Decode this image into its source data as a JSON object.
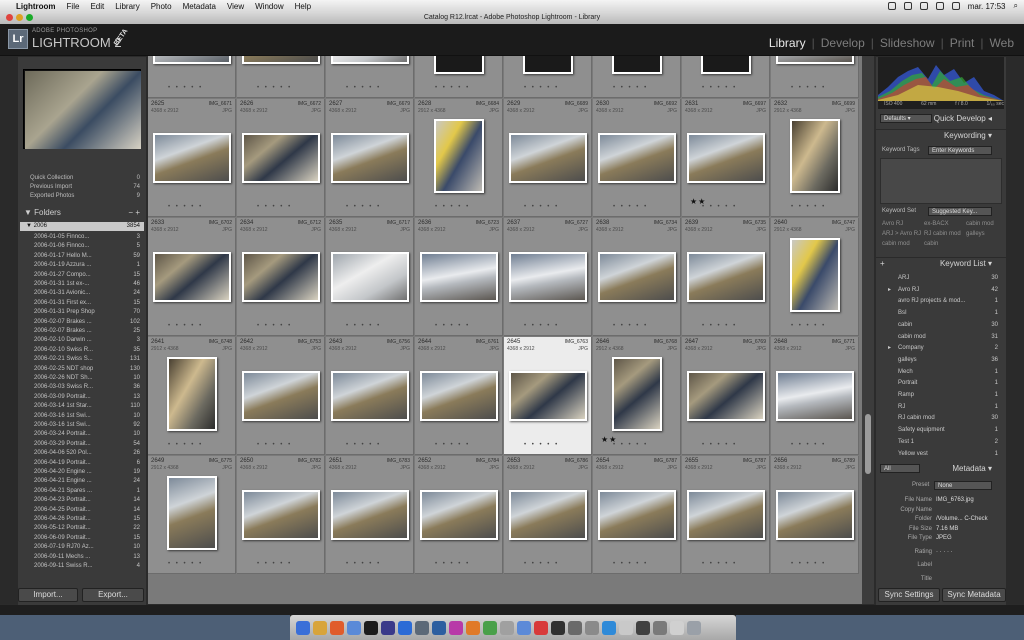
{
  "menubar": {
    "items": [
      "Lightroom",
      "File",
      "Edit",
      "Library",
      "Photo",
      "Metadata",
      "View",
      "Window",
      "Help"
    ],
    "clock": "mar. 17:53"
  },
  "window": {
    "title": "Catalog R12.lrcat - Adobe Photoshop Lightroom - Library"
  },
  "identity": {
    "logo": "Lr",
    "sub": "ADOBE PHOTOSHOP",
    "main": "LIGHTROOM 2",
    "badge": "BETA"
  },
  "modules": [
    "Library",
    "Develop",
    "Slideshow",
    "Print",
    "Web"
  ],
  "left": {
    "catalog_rows": [
      {
        "label": "Quick Collection",
        "count": "0"
      },
      {
        "label": "Previous Import",
        "count": "74"
      },
      {
        "label": "Exported Photos",
        "count": "9"
      }
    ],
    "folders_title": "Folders",
    "folder_root": {
      "label": "2006",
      "count": "3854"
    },
    "folders": [
      {
        "label": "2006-01-05 Finnco...",
        "count": "3"
      },
      {
        "label": "2006-01-06 Finnco...",
        "count": "5"
      },
      {
        "label": "2006-01-17 Hello M...",
        "count": "59"
      },
      {
        "label": "2006-01-19 Azzura ...",
        "count": "1"
      },
      {
        "label": "2006-01-27 Compo...",
        "count": "15"
      },
      {
        "label": "2006-01-31 1st ex-...",
        "count": "46"
      },
      {
        "label": "2006-01-31 Avionic...",
        "count": "24"
      },
      {
        "label": "2006-01-31 First ex...",
        "count": "15"
      },
      {
        "label": "2006-01-31 Prep Shop",
        "count": "70"
      },
      {
        "label": "2006-02-07 Brakes ...",
        "count": "102"
      },
      {
        "label": "2006-02-07 Brakes ...",
        "count": "25"
      },
      {
        "label": "2006-02-10 Darwin ...",
        "count": "3"
      },
      {
        "label": "2006-02-10 Swiss R...",
        "count": "35"
      },
      {
        "label": "2006-02-21 Swiss S...",
        "count": "131"
      },
      {
        "label": "2006-02-25 NDT shop",
        "count": "130"
      },
      {
        "label": "2006-02-26 NDT Sh...",
        "count": "10"
      },
      {
        "label": "2006-03-03 Swiss R...",
        "count": "36"
      },
      {
        "label": "2006-03-09 Portrait...",
        "count": "13"
      },
      {
        "label": "2006-03-14 1st Star...",
        "count": "110"
      },
      {
        "label": "2006-03-16 1st Swi...",
        "count": "10"
      },
      {
        "label": "2006-03-16 1st Swi...",
        "count": "92"
      },
      {
        "label": "2006-03-24 Portrait...",
        "count": "10"
      },
      {
        "label": "2006-03-29 Portrait...",
        "count": "54"
      },
      {
        "label": "2006-04-06 520 Pol...",
        "count": "26"
      },
      {
        "label": "2006-04-19 Portrait...",
        "count": "6"
      },
      {
        "label": "2006-04-20 Engine ...",
        "count": "19"
      },
      {
        "label": "2006-04-21 Engine ...",
        "count": "24"
      },
      {
        "label": "2006-04-21 Spares ...",
        "count": "1"
      },
      {
        "label": "2006-04-23 Portrait...",
        "count": "14"
      },
      {
        "label": "2006-04-25 Portrait...",
        "count": "14"
      },
      {
        "label": "2006-04-26 Portrait...",
        "count": "15"
      },
      {
        "label": "2006-05-12 Portrait...",
        "count": "22"
      },
      {
        "label": "2006-06-09 Portrait...",
        "count": "15"
      },
      {
        "label": "2006-07-19 RJ70 Az...",
        "count": "10"
      },
      {
        "label": "2006-09-11 Mechs ...",
        "count": "13"
      },
      {
        "label": "2006-09-11 Swiss R...",
        "count": "4"
      }
    ],
    "import_label": "Import...",
    "export_label": "Export..."
  },
  "grid": {
    "rows": [
      [
        {
          "num": "2617",
          "fn": "LH FR 10 to 14 04",
          "dim": "3000 x 1500",
          "ext": "JPG",
          "thumb": "fish"
        },
        {
          "num": "2618",
          "fn": "LH FR10 to 17",
          "dim": "3000 x 1500",
          "ext": "JPG",
          "thumb": "hangar"
        },
        {
          "num": "2619",
          "fn": "LH FR10 to 14 new skin",
          "dim": "3000 x 1500",
          "ext": "JPG",
          "thumb": "wing"
        },
        {
          "num": "2620",
          "fn": "IMG_6652",
          "dim": "2912 x 4368",
          "ext": "JPG",
          "thumb": "portrait"
        },
        {
          "num": "2621",
          "fn": "IMG_6654",
          "dim": "2912 x 4368",
          "ext": "JPG",
          "thumb": "portrait"
        },
        {
          "num": "2622",
          "fn": "IMG_6656",
          "dim": "2912 x 4368",
          "ext": "JPG",
          "thumb": "portrait"
        },
        {
          "num": "2623",
          "fn": "IMG_6658",
          "dim": "2912 x 4368",
          "ext": "JPG",
          "thumb": "portrait"
        },
        {
          "num": "2624",
          "fn": "IMG_6666",
          "dim": "4368 x 2912",
          "ext": "JPG",
          "thumb": "jet"
        }
      ],
      [
        {
          "num": "2625",
          "fn": "IMG_6671",
          "dim": "4368 x 2912",
          "ext": "JPG",
          "thumb": "hangar"
        },
        {
          "num": "2626",
          "fn": "IMG_6672",
          "dim": "4368 x 2912",
          "ext": "JPG",
          "thumb": "worker"
        },
        {
          "num": "2627",
          "fn": "IMG_6679",
          "dim": "4368 x 2912",
          "ext": "JPG",
          "thumb": "hangar"
        },
        {
          "num": "2628",
          "fn": "IMG_6684",
          "dim": "2912 x 4368",
          "ext": "JPG",
          "thumb": "scaffold"
        },
        {
          "num": "2629",
          "fn": "IMG_6689",
          "dim": "4368 x 2912",
          "ext": "JPG",
          "thumb": "hangar"
        },
        {
          "num": "2630",
          "fn": "IMG_6692",
          "dim": "4368 x 2912",
          "ext": "JPG",
          "thumb": "hangar"
        },
        {
          "num": "2631",
          "fn": "IMG_6697",
          "dim": "4368 x 2912",
          "ext": "JPG",
          "thumb": "hangar",
          "stars": "★★"
        },
        {
          "num": "2632",
          "fn": "IMG_6699",
          "dim": "2912 x 4368",
          "ext": "JPG",
          "thumb": "engine"
        }
      ],
      [
        {
          "num": "2633",
          "fn": "IMG_6702",
          "dim": "4368 x 2912",
          "ext": "JPG",
          "thumb": "worker"
        },
        {
          "num": "2634",
          "fn": "IMG_6712",
          "dim": "4368 x 2912",
          "ext": "JPG",
          "thumb": "worker"
        },
        {
          "num": "2635",
          "fn": "IMG_6717",
          "dim": "4368 x 2912",
          "ext": "JPG",
          "thumb": "wing"
        },
        {
          "num": "2636",
          "fn": "IMG_6723",
          "dim": "4368 x 2912",
          "ext": "JPG",
          "thumb": "jet"
        },
        {
          "num": "2637",
          "fn": "IMG_6727",
          "dim": "4368 x 2912",
          "ext": "JPG",
          "thumb": "jet"
        },
        {
          "num": "2638",
          "fn": "IMG_6734",
          "dim": "4368 x 2912",
          "ext": "JPG",
          "thumb": "hangar"
        },
        {
          "num": "2639",
          "fn": "IMG_6735",
          "dim": "4368 x 2912",
          "ext": "JPG",
          "thumb": "hangar"
        },
        {
          "num": "2640",
          "fn": "IMG_6747",
          "dim": "2912 x 4368",
          "ext": "JPG",
          "thumb": "scaffold"
        }
      ],
      [
        {
          "num": "2641",
          "fn": "IMG_6748",
          "dim": "2912 x 4368",
          "ext": "JPG",
          "thumb": "engine"
        },
        {
          "num": "2642",
          "fn": "IMG_6753",
          "dim": "4368 x 2912",
          "ext": "JPG",
          "thumb": "hangar"
        },
        {
          "num": "2643",
          "fn": "IMG_6756",
          "dim": "4368 x 2912",
          "ext": "JPG",
          "thumb": "hangar"
        },
        {
          "num": "2644",
          "fn": "IMG_6761",
          "dim": "4368 x 2912",
          "ext": "JPG",
          "thumb": "hangar"
        },
        {
          "num": "2645",
          "fn": "IMG_6763",
          "dim": "4368 x 2912",
          "ext": "JPG",
          "thumb": "worker",
          "sel": true
        },
        {
          "num": "2646",
          "fn": "IMG_6768",
          "dim": "2912 x 4368",
          "ext": "JPG",
          "thumb": "worker",
          "stars": "★★"
        },
        {
          "num": "2647",
          "fn": "IMG_6769",
          "dim": "4368 x 2912",
          "ext": "JPG",
          "thumb": "worker"
        },
        {
          "num": "2648",
          "fn": "IMG_6771",
          "dim": "4368 x 2912",
          "ext": "JPG",
          "thumb": "jet"
        }
      ],
      [
        {
          "num": "2649",
          "fn": "IMG_6775",
          "dim": "2912 x 4368",
          "ext": "JPG",
          "thumb": "hangar"
        },
        {
          "num": "2650",
          "fn": "IMG_6782",
          "dim": "4368 x 2912",
          "ext": "JPG",
          "thumb": "hangar"
        },
        {
          "num": "2651",
          "fn": "IMG_6783",
          "dim": "4368 x 2912",
          "ext": "JPG",
          "thumb": "hangar"
        },
        {
          "num": "2652",
          "fn": "IMG_6784",
          "dim": "4368 x 2912",
          "ext": "JPG",
          "thumb": "hangar"
        },
        {
          "num": "2653",
          "fn": "IMG_6786",
          "dim": "4368 x 2912",
          "ext": "JPG",
          "thumb": "hangar"
        },
        {
          "num": "2654",
          "fn": "IMG_6787",
          "dim": "4368 x 2912",
          "ext": "JPG",
          "thumb": "hangar"
        },
        {
          "num": "2655",
          "fn": "IMG_6787",
          "dim": "4368 x 2912",
          "ext": "JPG",
          "thumb": "hangar"
        },
        {
          "num": "2656",
          "fn": "IMG_6789",
          "dim": "4368 x 2912",
          "ext": "JPG",
          "thumb": "hangar"
        }
      ]
    ]
  },
  "right": {
    "hist_info": [
      "ISO 400",
      "62 mm",
      "f / 8.0",
      "1/₆₀ sec"
    ],
    "quick_develop": {
      "preset_label": "Defaults",
      "title": "Quick Develop"
    },
    "keywording": {
      "title": "Keywording",
      "tags_label": "Keyword Tags",
      "tags_value": "Enter Keywords",
      "set_label": "Keyword Set",
      "set_value": "Suggested Key...",
      "suggestions": [
        "Avro RJ",
        "ex-BACX",
        "cabin mod",
        "ARJ > Avro RJ",
        "RJ cabin mod",
        "galleys",
        "cabin mod",
        "cabin"
      ]
    },
    "keyword_list": {
      "title": "Keyword List",
      "items": [
        {
          "label": "ARJ",
          "count": "30"
        },
        {
          "label": "Avro RJ",
          "count": "42",
          "arrow": true
        },
        {
          "label": "avro RJ projects & mod...",
          "count": "1"
        },
        {
          "label": "BsI",
          "count": "1"
        },
        {
          "label": "cabin",
          "count": "30"
        },
        {
          "label": "cabin mod",
          "count": "31"
        },
        {
          "label": "Company",
          "count": "2",
          "arrow": true
        },
        {
          "label": "galleys",
          "count": "36"
        },
        {
          "label": "Mech",
          "count": "1"
        },
        {
          "label": "Portrait",
          "count": "1"
        },
        {
          "label": "Ramp",
          "count": "1"
        },
        {
          "label": "RJ",
          "count": "1"
        },
        {
          "label": "RJ cabin mod",
          "count": "30"
        },
        {
          "label": "Safety equipment",
          "count": "1"
        },
        {
          "label": "Test 1",
          "count": "2"
        },
        {
          "label": "Yellow vest",
          "count": "1"
        }
      ]
    },
    "metadata": {
      "filter": "All",
      "title": "Metadata",
      "preset_label": "Preset",
      "preset_value": "None",
      "fields": [
        {
          "label": "File Name",
          "value": "IMG_6763.jpg"
        },
        {
          "label": "Copy Name",
          "value": ""
        },
        {
          "label": "Folder",
          "value": "/Volume... C-Check"
        },
        {
          "label": "File Size",
          "value": "7.16 MB"
        },
        {
          "label": "File Type",
          "value": "JPEG"
        },
        {
          "label": "Rating",
          "value": "· · · · ·"
        },
        {
          "label": "Label",
          "value": ""
        },
        {
          "label": "Title",
          "value": ""
        }
      ]
    },
    "sync_settings": "Sync Settings",
    "sync_metadata": "Sync Metadata"
  }
}
